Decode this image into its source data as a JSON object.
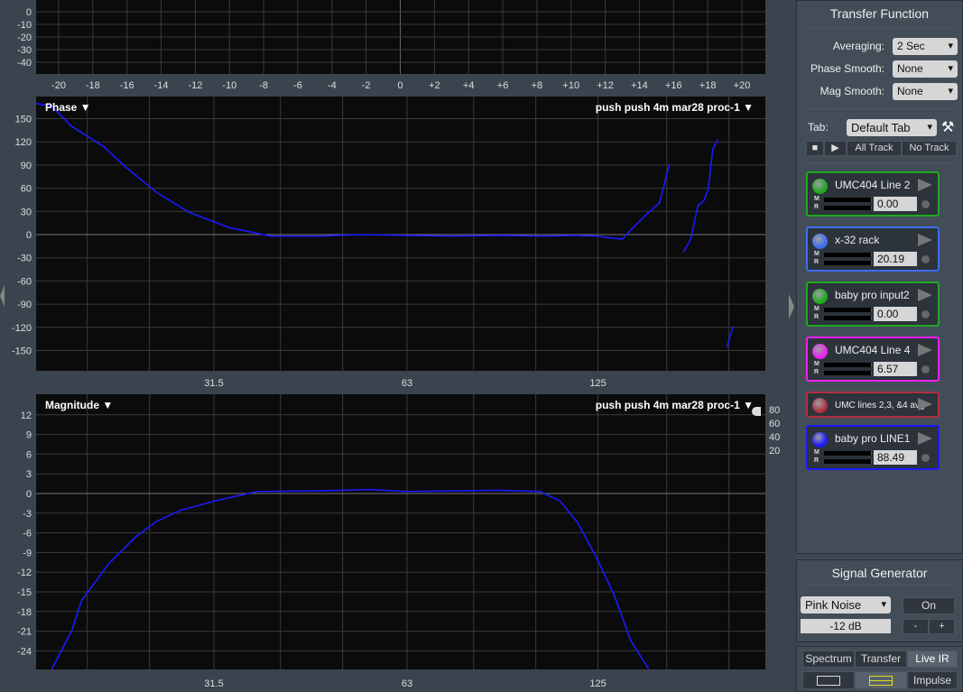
{
  "colors": {
    "trace": "#1a1aff",
    "grid": "#3a3a3a",
    "plot_bg": "#0b0b0b"
  },
  "impulse_plot": {
    "y_ticks": [
      "0",
      "-10",
      "-20",
      "-30",
      "-40"
    ],
    "x_ticks": [
      "-20",
      "-18",
      "-16",
      "-14",
      "-12",
      "-10",
      "-8",
      "-6",
      "-4",
      "-2",
      "0",
      "+2",
      "+4",
      "+6",
      "+8",
      "+10",
      "+12",
      "+14",
      "+16",
      "+18",
      "+20"
    ]
  },
  "phase_plot": {
    "label": "Phase ▼",
    "trace_label": "push push 4m mar28 proc-1 ▼",
    "y_ticks": [
      "150",
      "120",
      "90",
      "60",
      "30",
      "0",
      "-30",
      "-60",
      "-90",
      "-120",
      "-150"
    ],
    "x_ticks": [
      "31.5",
      "63",
      "125"
    ]
  },
  "magnitude_plot": {
    "label": "Magnitude ▼",
    "trace_label": "push push 4m mar28 proc-1 ▼",
    "y_ticks": [
      "12",
      "9",
      "6",
      "3",
      "0",
      "-3",
      "-6",
      "-9",
      "-12",
      "-15",
      "-18",
      "-21",
      "-24"
    ],
    "x_ticks": [
      "31.5",
      "63",
      "125"
    ],
    "coherence_ticks": [
      "80",
      "60",
      "40",
      "20"
    ]
  },
  "chart_data": [
    {
      "type": "line",
      "name": "phase",
      "x_scale": "log",
      "ylim": [
        -180,
        180
      ],
      "y_unit": "deg",
      "segments": [
        [
          [
            16.6,
            170
          ],
          [
            17.6,
            166
          ],
          [
            18.9,
            140
          ],
          [
            21.2,
            114
          ],
          [
            22.9,
            88
          ],
          [
            25.6,
            55
          ],
          [
            28.8,
            29
          ],
          [
            33.3,
            9
          ],
          [
            38.6,
            -2
          ],
          [
            45.9,
            -2
          ],
          [
            53.2,
            0
          ],
          [
            63,
            -1
          ],
          [
            74.6,
            -2
          ],
          [
            88,
            -1
          ],
          [
            103,
            -2
          ],
          [
            115,
            -1
          ],
          [
            124.7,
            -2
          ],
          [
            130,
            -4
          ],
          [
            136.5,
            -6
          ],
          [
            140.6,
            6
          ],
          [
            148.8,
            26
          ],
          [
            155.9,
            41
          ],
          [
            161.5,
            91
          ]
        ],
        [
          [
            169.8,
            -23
          ],
          [
            174.4,
            -6
          ],
          [
            178.9,
            37
          ],
          [
            182.8,
            44
          ],
          [
            185.6,
            58
          ],
          [
            188.8,
            111
          ],
          [
            192.2,
            123
          ]
        ],
        [
          [
            198.4,
            -146
          ],
          [
            203,
            -119
          ]
        ]
      ]
    },
    {
      "type": "line",
      "name": "magnitude",
      "x_scale": "log",
      "ylim": [
        -27,
        14
      ],
      "y_unit": "dB",
      "segments": [
        [
          [
            17.6,
            -26.8
          ],
          [
            18.9,
            -21
          ],
          [
            19.6,
            -16.3
          ],
          [
            21.6,
            -10.7
          ],
          [
            23.8,
            -6.6
          ],
          [
            25.6,
            -4.3
          ],
          [
            27.9,
            -2.6
          ],
          [
            31.7,
            -1.1
          ],
          [
            36.8,
            0.3
          ],
          [
            45.9,
            0.4
          ],
          [
            55,
            0.6
          ],
          [
            63,
            0.3
          ],
          [
            75,
            0.4
          ],
          [
            87,
            0.5
          ],
          [
            101.5,
            0.3
          ],
          [
            109,
            -1.1
          ],
          [
            116.3,
            -4.5
          ],
          [
            124.7,
            -10
          ],
          [
            132.5,
            -15.5
          ],
          [
            140.6,
            -22.4
          ],
          [
            150,
            -26.8
          ]
        ]
      ]
    }
  ],
  "sidebar": {
    "title": "Transfer Function",
    "averaging_label": "Averaging:",
    "averaging": "2 Sec",
    "phase_smooth_label": "Phase Smooth:",
    "phase_smooth": "None",
    "mag_smooth_label": "Mag Smooth:",
    "mag_smooth": "None",
    "tab_label": "Tab:",
    "tab": "Default Tab",
    "all_track": "All Track",
    "no_track": "No Track",
    "tracks": [
      {
        "name": "UMC404 Line 2",
        "value": "0.00",
        "color": "#1fa81f"
      },
      {
        "name": "x-32 rack",
        "value": "20.19",
        "color": "#3d6cf0"
      },
      {
        "name": "baby pro input2",
        "value": "0.00",
        "color": "#1fa81f"
      },
      {
        "name": "UMC404 Line 4",
        "value": "6.57",
        "color": "#f020f0"
      },
      {
        "name": "UMC lines 2,3, &4 avg",
        "value": "",
        "color": "#b03040"
      },
      {
        "name": "baby pro LINE1",
        "value": "88.49",
        "color": "#1a1aff"
      }
    ]
  },
  "signal_generator": {
    "title": "Signal Generator",
    "type": "Pink Noise",
    "on": "On",
    "level": "-12 dB",
    "minus": "-",
    "plus": "+"
  },
  "modes": {
    "spectrum": "Spectrum",
    "transfer": "Transfer",
    "live_ir": "Live IR",
    "impulse": "Impulse"
  }
}
